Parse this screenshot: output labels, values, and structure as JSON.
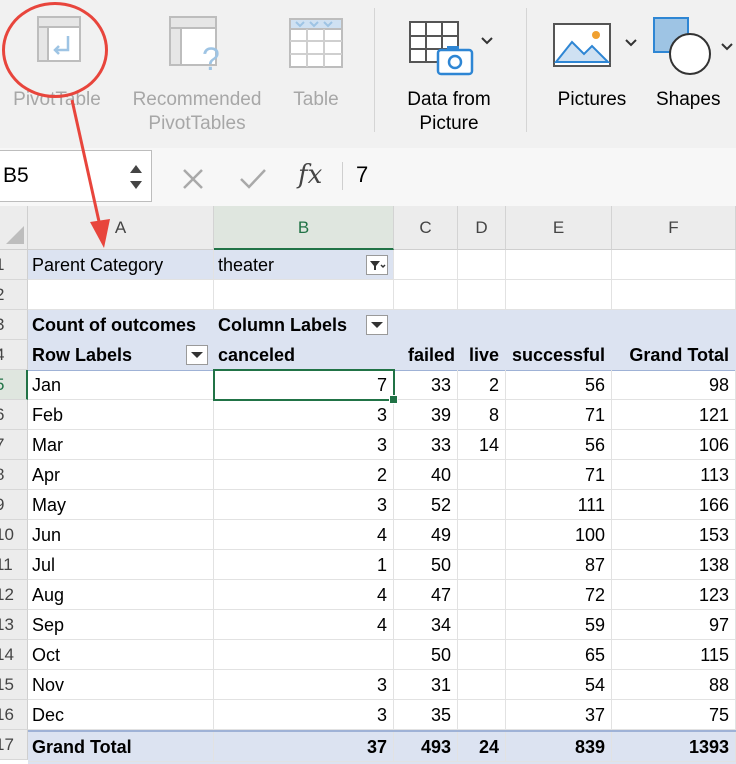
{
  "ribbon": {
    "pivot_table": "PivotTable",
    "recommended_line1": "Recommended",
    "recommended_line2": "PivotTables",
    "table": "Table",
    "data_from_line1": "Data from",
    "data_from_line2": "Picture",
    "pictures": "Pictures",
    "shapes": "Shapes"
  },
  "formula_bar": {
    "name_box": "B5",
    "cancel_icon": "x-icon",
    "enter_icon": "check-icon",
    "fx_label": "fx",
    "value": "7"
  },
  "columns": [
    "A",
    "B",
    "C",
    "D",
    "E",
    "F"
  ],
  "rows": [
    "1",
    "2",
    "3",
    "4",
    "5",
    "6",
    "7",
    "8",
    "9",
    "10",
    "11",
    "12",
    "13",
    "14",
    "15",
    "16",
    "17"
  ],
  "filter": {
    "label": "Parent Category",
    "value": "theater"
  },
  "pivot": {
    "count_label": "Count of outcomes",
    "column_labels": "Column Labels",
    "row_labels": "Row Labels",
    "headers": [
      "canceled",
      "failed",
      "live",
      "successful",
      "Grand Total"
    ],
    "data": [
      {
        "month": "Jan",
        "canceled": "7",
        "failed": "33",
        "live": "2",
        "successful": "56",
        "total": "98"
      },
      {
        "month": "Feb",
        "canceled": "3",
        "failed": "39",
        "live": "8",
        "successful": "71",
        "total": "121"
      },
      {
        "month": "Mar",
        "canceled": "3",
        "failed": "33",
        "live": "14",
        "successful": "56",
        "total": "106"
      },
      {
        "month": "Apr",
        "canceled": "2",
        "failed": "40",
        "live": "",
        "successful": "71",
        "total": "113"
      },
      {
        "month": "May",
        "canceled": "3",
        "failed": "52",
        "live": "",
        "successful": "111",
        "total": "166"
      },
      {
        "month": "Jun",
        "canceled": "4",
        "failed": "49",
        "live": "",
        "successful": "100",
        "total": "153"
      },
      {
        "month": "Jul",
        "canceled": "1",
        "failed": "50",
        "live": "",
        "successful": "87",
        "total": "138"
      },
      {
        "month": "Aug",
        "canceled": "4",
        "failed": "47",
        "live": "",
        "successful": "72",
        "total": "123"
      },
      {
        "month": "Sep",
        "canceled": "4",
        "failed": "34",
        "live": "",
        "successful": "59",
        "total": "97"
      },
      {
        "month": "Oct",
        "canceled": "",
        "failed": "50",
        "live": "",
        "successful": "65",
        "total": "115"
      },
      {
        "month": "Nov",
        "canceled": "3",
        "failed": "31",
        "live": "",
        "successful": "54",
        "total": "88"
      },
      {
        "month": "Dec",
        "canceled": "3",
        "failed": "35",
        "live": "",
        "successful": "37",
        "total": "75"
      }
    ],
    "grand_total": {
      "label": "Grand Total",
      "canceled": "37",
      "failed": "493",
      "live": "24",
      "successful": "839",
      "total": "1393"
    }
  },
  "colors": {
    "accent_green": "#217346",
    "band_blue": "#dce3f1",
    "annotation_red": "#e8453c"
  }
}
